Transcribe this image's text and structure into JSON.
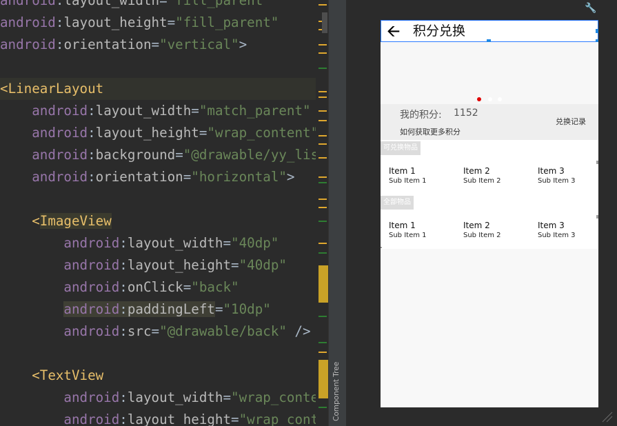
{
  "code": {
    "lines": [
      {
        "indent": "",
        "parts": [
          [
            "ns",
            "android"
          ],
          [
            "plain",
            ":"
          ],
          [
            "attr",
            "layout_width"
          ],
          [
            "plain",
            "="
          ],
          [
            "val",
            "\"fill_parent\""
          ]
        ]
      },
      {
        "indent": "",
        "parts": [
          [
            "ns",
            "android"
          ],
          [
            "plain",
            ":"
          ],
          [
            "attr",
            "layout_height"
          ],
          [
            "plain",
            "="
          ],
          [
            "val",
            "\"fill_parent\""
          ]
        ]
      },
      {
        "indent": "",
        "parts": [
          [
            "ns",
            "android"
          ],
          [
            "plain",
            ":"
          ],
          [
            "attr",
            "orientation"
          ],
          [
            "plain",
            "="
          ],
          [
            "val",
            "\"vertical\""
          ],
          [
            "plain",
            ">"
          ]
        ]
      },
      {
        "indent": "",
        "parts": []
      },
      {
        "indent": "",
        "parts": [
          [
            "tag",
            "<"
          ],
          [
            "tag",
            "LinearLayout"
          ]
        ]
      },
      {
        "indent": "    ",
        "parts": [
          [
            "ns",
            "android"
          ],
          [
            "plain",
            ":"
          ],
          [
            "attr",
            "layout_width"
          ],
          [
            "plain",
            "="
          ],
          [
            "val",
            "\"match_parent\""
          ]
        ]
      },
      {
        "indent": "    ",
        "parts": [
          [
            "ns",
            "android"
          ],
          [
            "plain",
            ":"
          ],
          [
            "attr",
            "layout_height"
          ],
          [
            "plain",
            "="
          ],
          [
            "val",
            "\"wrap_content\""
          ]
        ]
      },
      {
        "indent": "    ",
        "parts": [
          [
            "ns",
            "android"
          ],
          [
            "plain",
            ":"
          ],
          [
            "attr",
            "background"
          ],
          [
            "plain",
            "="
          ],
          [
            "val",
            "\"@drawable/yy_lis"
          ]
        ]
      },
      {
        "indent": "    ",
        "parts": [
          [
            "ns",
            "android"
          ],
          [
            "plain",
            ":"
          ],
          [
            "attr",
            "orientation"
          ],
          [
            "plain",
            "="
          ],
          [
            "val",
            "\"horizontal\""
          ],
          [
            "plain",
            ">"
          ]
        ]
      },
      {
        "indent": "",
        "parts": []
      },
      {
        "indent": "    ",
        "parts": [
          [
            "tag",
            "<"
          ],
          [
            "tagbg",
            "ImageView"
          ]
        ]
      },
      {
        "indent": "        ",
        "parts": [
          [
            "ns",
            "android"
          ],
          [
            "plain",
            ":"
          ],
          [
            "attr",
            "layout_width"
          ],
          [
            "plain",
            "="
          ],
          [
            "val",
            "\"40dp\""
          ]
        ]
      },
      {
        "indent": "        ",
        "parts": [
          [
            "ns",
            "android"
          ],
          [
            "plain",
            ":"
          ],
          [
            "attr",
            "layout_height"
          ],
          [
            "plain",
            "="
          ],
          [
            "val",
            "\"40dp\""
          ]
        ]
      },
      {
        "indent": "        ",
        "parts": [
          [
            "ns",
            "android"
          ],
          [
            "plain",
            ":"
          ],
          [
            "attr",
            "onClick"
          ],
          [
            "plain",
            "="
          ],
          [
            "val",
            "\"back\""
          ]
        ]
      },
      {
        "indent": "        ",
        "parts": [
          [
            "nsbg",
            "android"
          ],
          [
            "plainbg",
            ":"
          ],
          [
            "attrbg",
            "paddingLeft"
          ],
          [
            "plain",
            "="
          ],
          [
            "val",
            "\"10dp\""
          ]
        ]
      },
      {
        "indent": "        ",
        "parts": [
          [
            "ns",
            "android"
          ],
          [
            "plain",
            ":"
          ],
          [
            "attr",
            "src"
          ],
          [
            "plain",
            "="
          ],
          [
            "val",
            "\"@drawable/back\""
          ],
          [
            "plain",
            " />"
          ]
        ]
      },
      {
        "indent": "",
        "parts": []
      },
      {
        "indent": "    ",
        "parts": [
          [
            "tag",
            "<"
          ],
          [
            "tag",
            "TextView"
          ]
        ]
      },
      {
        "indent": "        ",
        "parts": [
          [
            "ns",
            "android"
          ],
          [
            "plain",
            ":"
          ],
          [
            "attr",
            "layout_width"
          ],
          [
            "plain",
            "="
          ],
          [
            "val",
            "\"wrap_conte"
          ]
        ]
      },
      {
        "indent": "        ",
        "parts": [
          [
            "ns",
            "android"
          ],
          [
            "plain",
            ":"
          ],
          [
            "attr",
            "layout_height"
          ],
          [
            "plain",
            "="
          ],
          [
            "val",
            "\"wrap_cont"
          ]
        ]
      }
    ]
  },
  "sidebar": {
    "label": "Component Tree"
  },
  "preview": {
    "title": "积分兑换",
    "back_icon": "arrow-left-icon",
    "points_label": "我的积分:",
    "points_value": "1152",
    "record_link": "兑换记录",
    "howto_link": "如何获取更多积分",
    "section_exchangeable": "可兑换物品",
    "section_all": "全部物品",
    "grid1": [
      {
        "title": "Item 1",
        "sub": "Sub Item 1"
      },
      {
        "title": "Item 2",
        "sub": "Sub Item 2"
      },
      {
        "title": "Item 3",
        "sub": "Sub Item 3"
      }
    ],
    "grid2": [
      {
        "title": "Item 1",
        "sub": "Sub Item 1"
      },
      {
        "title": "Item 2",
        "sub": "Sub Item 2"
      },
      {
        "title": "Item 3",
        "sub": "Sub Item 3"
      }
    ],
    "banner_dots": [
      "#e00000",
      "#ffffff",
      "#ffffff"
    ]
  },
  "colors": {
    "editor_bg": "#2b2b2b",
    "selection_blue": "#2979ff",
    "gutter_yellow": "#e0a82e",
    "gutter_green": "#2e7d32"
  }
}
